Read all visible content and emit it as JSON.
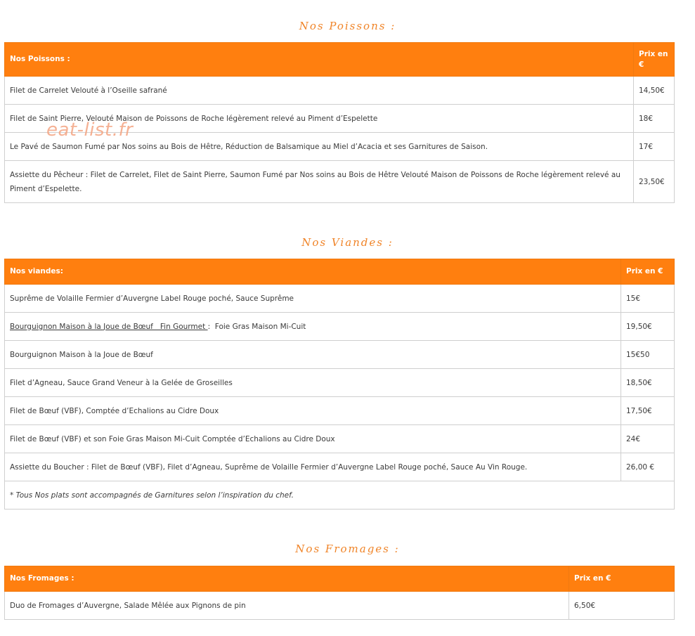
{
  "watermark": "eat-list.fr",
  "poissons": {
    "section_title": "Nos Poissons :",
    "header_dish": "Nos Poissons :",
    "header_price": "Prix en €",
    "rows": [
      {
        "dish": "Filet de Carrelet Velouté à l’Oseille safrané",
        "price": "14,50€"
      },
      {
        "dish": "Filet de Saint Pierre, Velouté Maison de Poissons de Roche légèrement relevé au Piment d’Espelette",
        "price": "18€"
      },
      {
        "dish": "Le Pavé de Saumon Fumé par Nos soins au Bois de Hêtre, Réduction de Balsamique au Miel d’Acacia et ses Garnitures de Saison.",
        "price": "17€"
      },
      {
        "dish": "Assiette du Pêcheur : Filet de Carrelet, Filet de Saint Pierre, Saumon Fumé par Nos soins au Bois de Hêtre Velouté Maison de Poissons de Roche légèrement relevé au Piment d’Espelette.",
        "price": "23,50€"
      }
    ]
  },
  "viandes": {
    "section_title": "Nos Viandes :",
    "header_dish": "Nos viandes:",
    "header_price": "Prix en €",
    "rows": [
      {
        "dish": "Suprême de Volaille Fermier d’Auvergne Label Rouge poché, Sauce Suprême",
        "price": "15€"
      },
      {
        "dish_link": "Bourguignon Maison à la Joue de Bœuf   Fin Gourmet ",
        "dish_rest": ":  Foie Gras Maison Mi-Cuit",
        "price": "19,50€"
      },
      {
        "dish": "Bourguignon Maison à la Joue de Bœuf",
        "price": "15€50"
      },
      {
        "dish": "Filet d’Agneau, Sauce Grand Veneur à la Gelée de Groseilles",
        "price": "18,50€"
      },
      {
        "dish": "Filet de Bœuf (VBF), Comptée d’Echalions au Cidre Doux",
        "price": "17,50€"
      },
      {
        "dish": "Filet de Bœuf (VBF) et son Foie Gras Maison Mi-Cuit Comptée d’Echalions au Cidre Doux",
        "price": "24€"
      },
      {
        "dish": "Assiette du Boucher : Filet de Bœuf (VBF), Filet d’Agneau, Suprême de Volaille Fermier d’Auvergne Label Rouge poché, Sauce Au Vin Rouge.",
        "price": "26,00 €"
      }
    ],
    "note": "* Tous Nos plats sont accompagnés de Garnitures selon l’inspiration du chef."
  },
  "fromages": {
    "section_title": "Nos Fromages :",
    "header_dish": "Nos Fromages :",
    "header_price": "Prix en €",
    "rows": [
      {
        "dish": "Duo de Fromages d’Auvergne, Salade Mêlée aux Pignons de pin",
        "price": "6,50€"
      }
    ]
  }
}
